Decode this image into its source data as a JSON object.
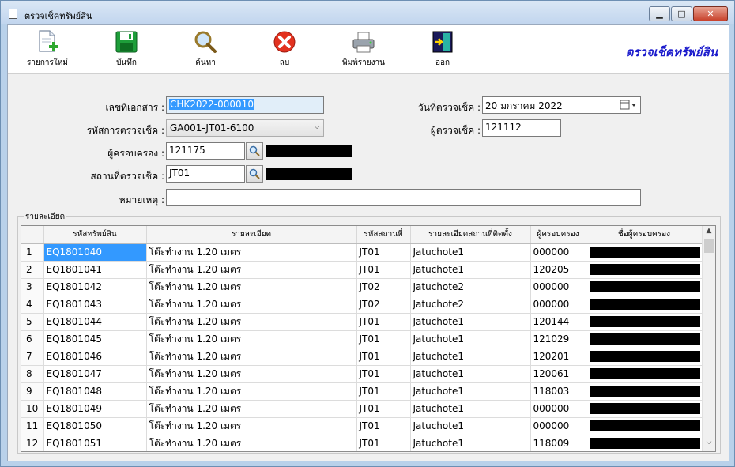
{
  "window": {
    "title": "ตรวจเช็คทรัพย์สิน"
  },
  "toolbar": {
    "items": [
      {
        "label": "รายการใหม่",
        "icon": "new-document-icon"
      },
      {
        "label": "บันทึก",
        "icon": "save-floppy-icon"
      },
      {
        "label": "ค้นหา",
        "icon": "search-magnifier-icon"
      },
      {
        "label": "ลบ",
        "icon": "delete-x-icon"
      },
      {
        "label": "พิมพ์รายงาน",
        "icon": "printer-icon"
      },
      {
        "label": "ออก",
        "icon": "exit-door-icon"
      }
    ],
    "brand_title": "ตรวจเช็คทรัพย์สิน"
  },
  "form": {
    "doc_no_label": "เลขที่เอกสาร :",
    "doc_no_value": "CHK2022-000010",
    "check_code_label": "รหัสการตรวจเช็ค :",
    "check_code_value": "GA001-JT01-6100",
    "owner_label": "ผู้ครอบครอง :",
    "owner_value": "121175",
    "location_label": "สถานที่ตรวจเช็ค :",
    "location_value": "JT01",
    "remark_label": "หมายเหตุ :",
    "remark_value": "",
    "check_date_label": "วันที่ตรวจเช็ค :",
    "check_date_value": "20  มกราคม   2022",
    "inspector_label": "ผู้ตรวจเช็ค :",
    "inspector_value": "121112"
  },
  "details": {
    "group_label": "รายละเอียด",
    "columns": [
      "",
      "รหัสทรัพย์สิน",
      "รายละเอียด",
      "รหัสสถานที่",
      "รายละเอียดสถานที่ติดตั้ง",
      "ผู้ครอบครอง",
      "ชื่อผู้ครอบครอง"
    ],
    "rows": [
      {
        "no": "1",
        "asset": "EQ1801040",
        "desc": "โต๊ะทำงาน 1.20 เมตร",
        "loc": "JT01",
        "loc_desc": "Jatuchote1",
        "owner": "000000"
      },
      {
        "no": "2",
        "asset": "EQ1801041",
        "desc": "โต๊ะทำงาน 1.20 เมตร",
        "loc": "JT01",
        "loc_desc": "Jatuchote1",
        "owner": "120205"
      },
      {
        "no": "3",
        "asset": "EQ1801042",
        "desc": "โต๊ะทำงาน 1.20 เมตร",
        "loc": "JT02",
        "loc_desc": "Jatuchote2",
        "owner": "000000"
      },
      {
        "no": "4",
        "asset": "EQ1801043",
        "desc": "โต๊ะทำงาน 1.20 เมตร",
        "loc": "JT02",
        "loc_desc": "Jatuchote2",
        "owner": "000000"
      },
      {
        "no": "5",
        "asset": "EQ1801044",
        "desc": "โต๊ะทำงาน 1.20 เมตร",
        "loc": "JT01",
        "loc_desc": "Jatuchote1",
        "owner": "120144"
      },
      {
        "no": "6",
        "asset": "EQ1801045",
        "desc": "โต๊ะทำงาน 1.20 เมตร",
        "loc": "JT01",
        "loc_desc": "Jatuchote1",
        "owner": "121029"
      },
      {
        "no": "7",
        "asset": "EQ1801046",
        "desc": "โต๊ะทำงาน 1.20 เมตร",
        "loc": "JT01",
        "loc_desc": "Jatuchote1",
        "owner": "120201"
      },
      {
        "no": "8",
        "asset": "EQ1801047",
        "desc": "โต๊ะทำงาน 1.20 เมตร",
        "loc": "JT01",
        "loc_desc": "Jatuchote1",
        "owner": "120061"
      },
      {
        "no": "9",
        "asset": "EQ1801048",
        "desc": "โต๊ะทำงาน 1.20 เมตร",
        "loc": "JT01",
        "loc_desc": "Jatuchote1",
        "owner": "118003"
      },
      {
        "no": "10",
        "asset": "EQ1801049",
        "desc": "โต๊ะทำงาน 1.20 เมตร",
        "loc": "JT01",
        "loc_desc": "Jatuchote1",
        "owner": "000000"
      },
      {
        "no": "11",
        "asset": "EQ1801050",
        "desc": "โต๊ะทำงาน 1.20 เมตร",
        "loc": "JT01",
        "loc_desc": "Jatuchote1",
        "owner": "000000"
      },
      {
        "no": "12",
        "asset": "EQ1801051",
        "desc": "โต๊ะทำงาน 1.20 เมตร",
        "loc": "JT01",
        "loc_desc": "Jatuchote1",
        "owner": "118009"
      }
    ]
  }
}
